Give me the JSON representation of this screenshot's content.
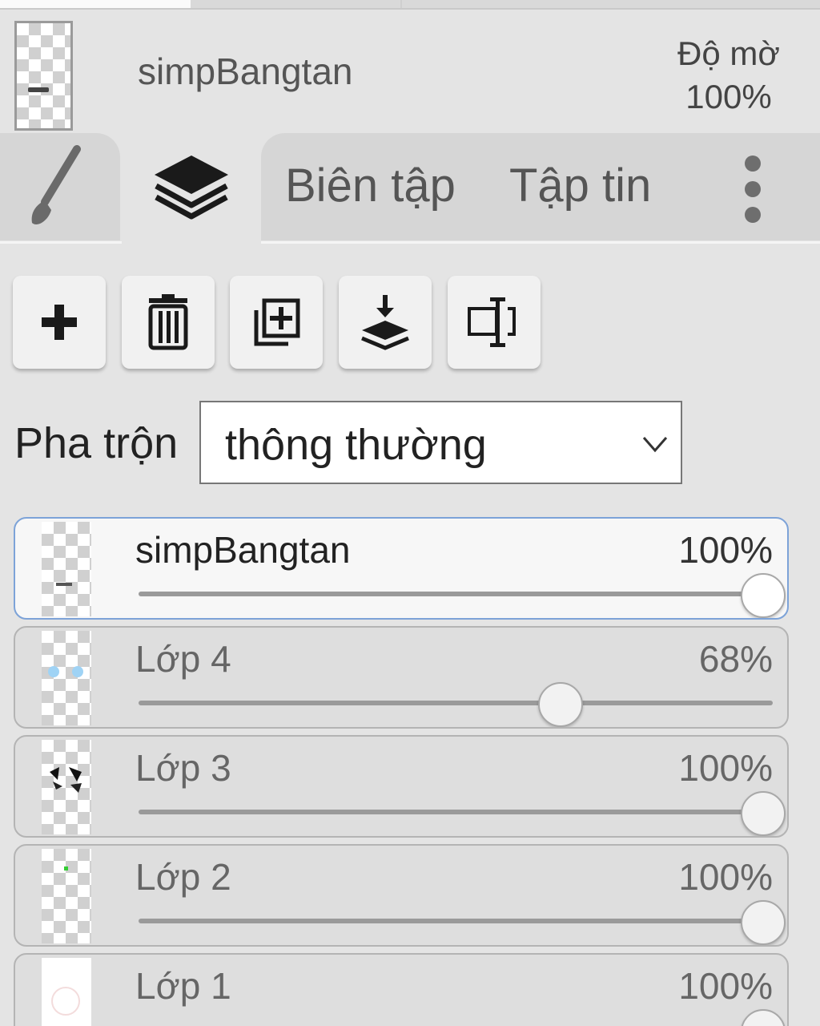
{
  "header": {
    "layer_name": "simpBangtan",
    "opacity_label": "Độ mờ",
    "opacity_value": "100%"
  },
  "tabs": {
    "brush_icon": "brush-icon",
    "layers_icon": "layers-icon",
    "edit_label": "Biên tập",
    "file_label": "Tập tin",
    "more_icon": "more-vertical-icon"
  },
  "toolbar": {
    "buttons": [
      "add-icon",
      "trash-icon",
      "duplicate-icon",
      "merge-down-icon",
      "text-cursor-icon"
    ]
  },
  "blend": {
    "label": "Pha trộn",
    "value": "thông thường"
  },
  "layers": [
    {
      "name": "simpBangtan",
      "opacity_text": "100%",
      "opacity": 1.0,
      "selected": true
    },
    {
      "name": "Lớp 4",
      "opacity_text": "68%",
      "opacity": 0.68,
      "selected": false
    },
    {
      "name": "Lớp 3",
      "opacity_text": "100%",
      "opacity": 1.0,
      "selected": false
    },
    {
      "name": "Lớp 2",
      "opacity_text": "100%",
      "opacity": 1.0,
      "selected": false
    },
    {
      "name": "Lớp 1",
      "opacity_text": "100%",
      "opacity": 1.0,
      "selected": false
    }
  ],
  "colors": {
    "background": "#e4e4e4",
    "selected_border": "#7da3d8"
  }
}
